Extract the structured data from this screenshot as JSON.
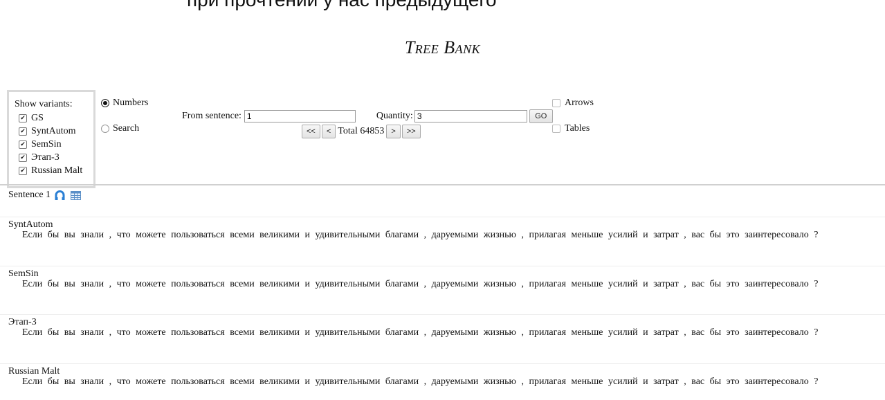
{
  "header": {
    "top_strip": "при прочтении у нас предыдущего",
    "title": "Tree Bank"
  },
  "variants": {
    "label": "Show variants:",
    "items": [
      {
        "label": "GS",
        "checked": true
      },
      {
        "label": "SyntAutom",
        "checked": true
      },
      {
        "label": "SemSin",
        "checked": true
      },
      {
        "label": "Этап-3",
        "checked": true
      },
      {
        "label": "Russian Malt",
        "checked": true
      }
    ]
  },
  "mode": {
    "numbers_label": "Numbers",
    "search_label": "Search",
    "selected": "Numbers"
  },
  "controls": {
    "from_label": "From sentence:",
    "from_value": "1",
    "quantity_label": "Quantity:",
    "quantity_value": "3",
    "go_label": "GO",
    "first_label": "<<",
    "prev_label": "<",
    "total_text": "Total 64853",
    "next_label": ">",
    "last_label": ">>"
  },
  "options": {
    "arrows_label": "Arrows",
    "tables_label": "Tables"
  },
  "sentence": {
    "label": "Sentence 1",
    "sections": [
      {
        "name": "SyntAutom",
        "text": "Если бы вы знали , что можете пользоваться всеми великими и удивительными благами , даруемыми жизнью , прилагая меньше усилий и затрат , вас бы это заинтересовало ?"
      },
      {
        "name": "SemSin",
        "text": "Если бы вы знали , что можете пользоваться всеми великими и удивительными благами , даруемыми жизнью , прилагая меньше усилий и затрат , вас бы это заинтересовало ?"
      },
      {
        "name": "Этап-3",
        "text": "Если бы вы знали , что можете пользоваться всеми великими и удивительными благами , даруемыми жизнью , прилагая меньше усилий и затрат , вас бы это заинтересовало ?"
      },
      {
        "name": "Russian Malt",
        "text": "Если бы вы знали , что можете пользоваться всеми великими и удивительными благами , даруемыми жизнью , прилагая меньше усилий и затрат , вас бы это заинтересовало ?"
      }
    ]
  },
  "icons": {
    "arrows_view": "tree-arrows-icon",
    "table_view": "table-icon"
  },
  "colors": {
    "icon_blue": "#2a7fd4",
    "divider": "#d0d0d0"
  }
}
